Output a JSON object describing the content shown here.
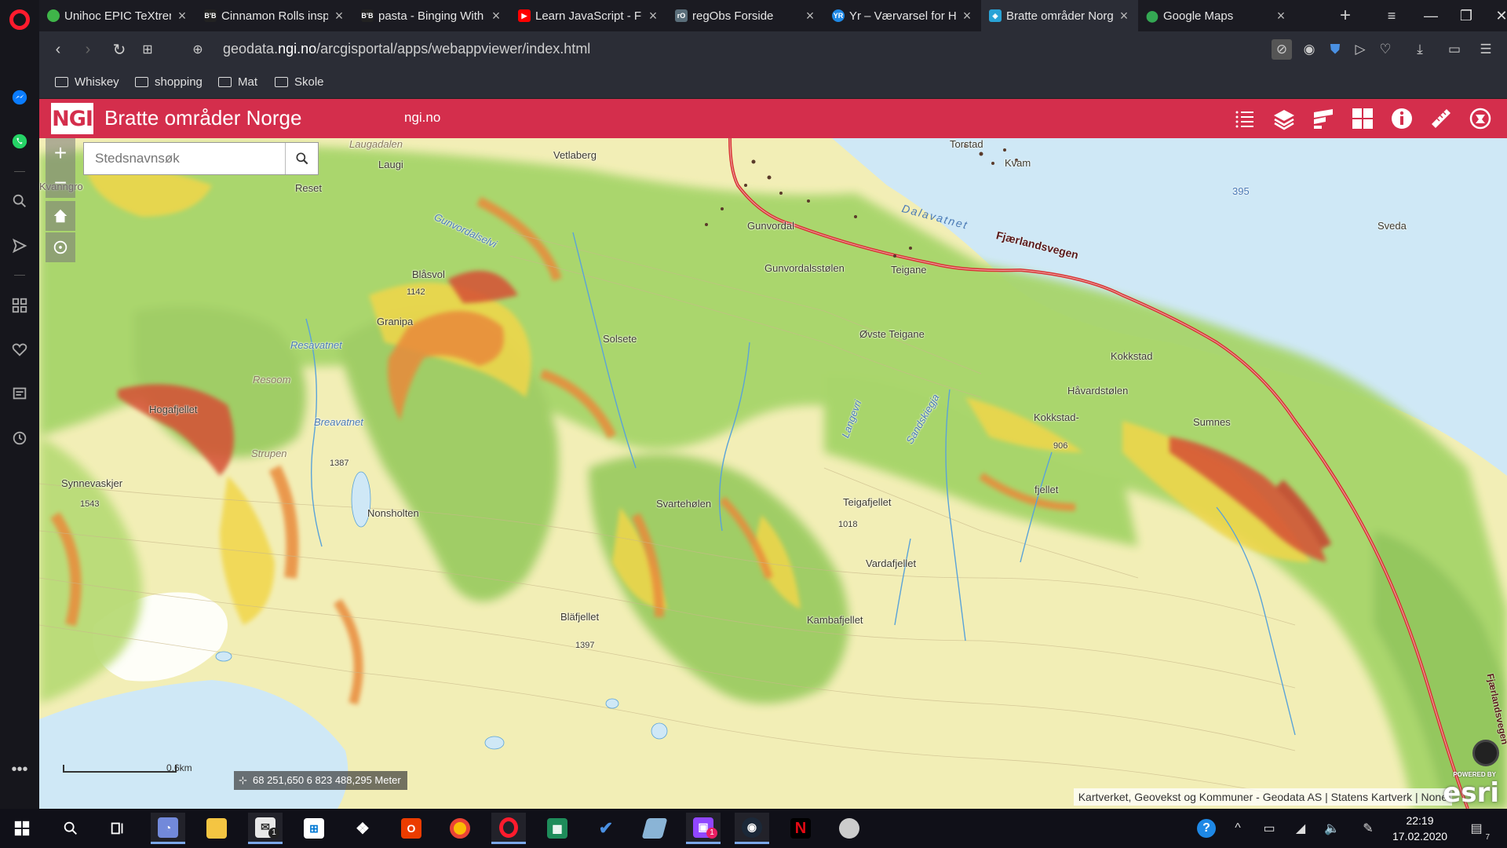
{
  "browser": {
    "tabs": [
      {
        "title": "Unihoc EPIC TeXtreme",
        "favicon": "green-circle-icon",
        "color": "#3fb549"
      },
      {
        "title": "Cinnamon Rolls inspired",
        "favicon": "bb-logo-icon",
        "color": "#222222"
      },
      {
        "title": "pasta - Binging With",
        "favicon": "bb-logo-icon",
        "color": "#222222"
      },
      {
        "title": "Learn JavaScript - Full",
        "favicon": "youtube-icon",
        "color": "#ff0000"
      },
      {
        "title": "regObs Forside",
        "favicon": "regobs-icon",
        "color": "#5a6e7a"
      },
      {
        "title": "Yr – Værvarsel for Hele",
        "favicon": "yr-icon",
        "color": "#1e88e5"
      },
      {
        "title": "Bratte områder Norge",
        "favicon": "ngi-map-icon",
        "color": "#29a3d6",
        "active": true
      },
      {
        "title": "Google Maps",
        "favicon": "google-maps-icon",
        "color": "#34a853"
      }
    ],
    "url_prefix": "geodata.",
    "url_domain": "ngi.no",
    "url_path": "/arcgisportal/apps/webappviewer/index.html",
    "bookmarks": [
      "Whiskey",
      "shopping",
      "Mat",
      "Skole"
    ]
  },
  "app": {
    "logo_text": "NGI",
    "title": "Bratte områder Norge",
    "link": "ngi.no",
    "brand_color": "#d42e4c",
    "tools": [
      "list-icon",
      "layers-icon",
      "legend-icon",
      "basemap-gallery-icon",
      "info-icon",
      "measure-icon",
      "slope-tool-icon"
    ]
  },
  "map": {
    "search_placeholder": "Stedsnavnsøk",
    "coordinates": "68 251,650 6 823 488,295 Meter",
    "scale_label": "0.6km",
    "attribution": "Kartverket, Geovekst og Kommuner - Geodata AS | Statens Kartverk | None",
    "esri_powered": "POWERED BY",
    "esri_logo": "esri",
    "place_names": [
      "Laugadalen",
      "Laugi",
      "Vetlaberg",
      "Torstad",
      "Kvam",
      "Reset",
      "Kvanngro",
      "Gunvordal",
      "Gunvordalsstølen",
      "Teigane",
      "Dalavatnet",
      "395",
      "Sveda",
      "Gunvordalselvi",
      "Blåsvol",
      "1142",
      "Granipa",
      "Resavatnet",
      "Solsete",
      "Øvste Teigane",
      "Kokkstad",
      "Håvardstølen",
      "Kokkstad-",
      "906",
      "Sumnes",
      "Resoom",
      "Hogafjellet",
      "Breavatnet",
      "Strupen",
      "1387",
      "Synnevaskjer",
      "1543",
      "Nonsholten",
      "Svartehølen",
      "Teigafjellet",
      "1018",
      "fjellet",
      "Vardafjellet",
      "Bläfjellet",
      "1397",
      "Kambafjellet",
      "Sandskiegja",
      "Langevri"
    ],
    "road_name": "Fjærlandsvegen",
    "road_name_2": "Fjærlandsvegen",
    "water_name": "Dalavatnet"
  },
  "taskbar": {
    "time": "22:19",
    "date": "17.02.2020",
    "notification_count": "7",
    "mail_badge": "1",
    "twitch_badge": "1",
    "apps": [
      "start-icon",
      "search-icon",
      "task-view-icon",
      "discord-icon",
      "file-explorer-icon",
      "mail-icon",
      "store-icon",
      "dropbox-icon",
      "office-icon",
      "chrome-icon",
      "opera-icon",
      "calculator-icon",
      "todo-icon",
      "scratch-icon",
      "twitch-icon",
      "steam-icon",
      "netflix-icon",
      "chrome-alt-icon"
    ]
  }
}
